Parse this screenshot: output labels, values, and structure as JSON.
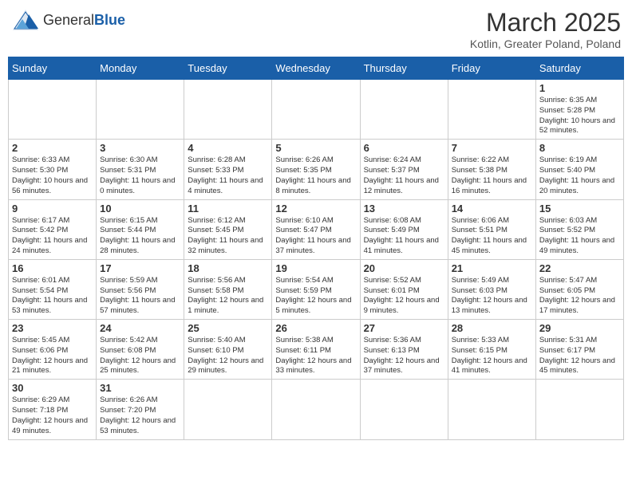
{
  "header": {
    "logo_general": "General",
    "logo_blue": "Blue",
    "month_title": "March 2025",
    "subtitle": "Kotlin, Greater Poland, Poland"
  },
  "days_of_week": [
    "Sunday",
    "Monday",
    "Tuesday",
    "Wednesday",
    "Thursday",
    "Friday",
    "Saturday"
  ],
  "weeks": [
    [
      null,
      null,
      null,
      null,
      null,
      null,
      {
        "num": "1",
        "info": "Sunrise: 6:35 AM\nSunset: 5:28 PM\nDaylight: 10 hours and 52 minutes."
      }
    ],
    [
      {
        "num": "2",
        "info": "Sunrise: 6:33 AM\nSunset: 5:30 PM\nDaylight: 10 hours and 56 minutes."
      },
      {
        "num": "3",
        "info": "Sunrise: 6:30 AM\nSunset: 5:31 PM\nDaylight: 11 hours and 0 minutes."
      },
      {
        "num": "4",
        "info": "Sunrise: 6:28 AM\nSunset: 5:33 PM\nDaylight: 11 hours and 4 minutes."
      },
      {
        "num": "5",
        "info": "Sunrise: 6:26 AM\nSunset: 5:35 PM\nDaylight: 11 hours and 8 minutes."
      },
      {
        "num": "6",
        "info": "Sunrise: 6:24 AM\nSunset: 5:37 PM\nDaylight: 11 hours and 12 minutes."
      },
      {
        "num": "7",
        "info": "Sunrise: 6:22 AM\nSunset: 5:38 PM\nDaylight: 11 hours and 16 minutes."
      },
      {
        "num": "8",
        "info": "Sunrise: 6:19 AM\nSunset: 5:40 PM\nDaylight: 11 hours and 20 minutes."
      }
    ],
    [
      {
        "num": "9",
        "info": "Sunrise: 6:17 AM\nSunset: 5:42 PM\nDaylight: 11 hours and 24 minutes."
      },
      {
        "num": "10",
        "info": "Sunrise: 6:15 AM\nSunset: 5:44 PM\nDaylight: 11 hours and 28 minutes."
      },
      {
        "num": "11",
        "info": "Sunrise: 6:12 AM\nSunset: 5:45 PM\nDaylight: 11 hours and 32 minutes."
      },
      {
        "num": "12",
        "info": "Sunrise: 6:10 AM\nSunset: 5:47 PM\nDaylight: 11 hours and 37 minutes."
      },
      {
        "num": "13",
        "info": "Sunrise: 6:08 AM\nSunset: 5:49 PM\nDaylight: 11 hours and 41 minutes."
      },
      {
        "num": "14",
        "info": "Sunrise: 6:06 AM\nSunset: 5:51 PM\nDaylight: 11 hours and 45 minutes."
      },
      {
        "num": "15",
        "info": "Sunrise: 6:03 AM\nSunset: 5:52 PM\nDaylight: 11 hours and 49 minutes."
      }
    ],
    [
      {
        "num": "16",
        "info": "Sunrise: 6:01 AM\nSunset: 5:54 PM\nDaylight: 11 hours and 53 minutes."
      },
      {
        "num": "17",
        "info": "Sunrise: 5:59 AM\nSunset: 5:56 PM\nDaylight: 11 hours and 57 minutes."
      },
      {
        "num": "18",
        "info": "Sunrise: 5:56 AM\nSunset: 5:58 PM\nDaylight: 12 hours and 1 minute."
      },
      {
        "num": "19",
        "info": "Sunrise: 5:54 AM\nSunset: 5:59 PM\nDaylight: 12 hours and 5 minutes."
      },
      {
        "num": "20",
        "info": "Sunrise: 5:52 AM\nSunset: 6:01 PM\nDaylight: 12 hours and 9 minutes."
      },
      {
        "num": "21",
        "info": "Sunrise: 5:49 AM\nSunset: 6:03 PM\nDaylight: 12 hours and 13 minutes."
      },
      {
        "num": "22",
        "info": "Sunrise: 5:47 AM\nSunset: 6:05 PM\nDaylight: 12 hours and 17 minutes."
      }
    ],
    [
      {
        "num": "23",
        "info": "Sunrise: 5:45 AM\nSunset: 6:06 PM\nDaylight: 12 hours and 21 minutes."
      },
      {
        "num": "24",
        "info": "Sunrise: 5:42 AM\nSunset: 6:08 PM\nDaylight: 12 hours and 25 minutes."
      },
      {
        "num": "25",
        "info": "Sunrise: 5:40 AM\nSunset: 6:10 PM\nDaylight: 12 hours and 29 minutes."
      },
      {
        "num": "26",
        "info": "Sunrise: 5:38 AM\nSunset: 6:11 PM\nDaylight: 12 hours and 33 minutes."
      },
      {
        "num": "27",
        "info": "Sunrise: 5:36 AM\nSunset: 6:13 PM\nDaylight: 12 hours and 37 minutes."
      },
      {
        "num": "28",
        "info": "Sunrise: 5:33 AM\nSunset: 6:15 PM\nDaylight: 12 hours and 41 minutes."
      },
      {
        "num": "29",
        "info": "Sunrise: 5:31 AM\nSunset: 6:17 PM\nDaylight: 12 hours and 45 minutes."
      }
    ],
    [
      {
        "num": "30",
        "info": "Sunrise: 6:29 AM\nSunset: 7:18 PM\nDaylight: 12 hours and 49 minutes."
      },
      {
        "num": "31",
        "info": "Sunrise: 6:26 AM\nSunset: 7:20 PM\nDaylight: 12 hours and 53 minutes."
      },
      null,
      null,
      null,
      null,
      null
    ]
  ]
}
